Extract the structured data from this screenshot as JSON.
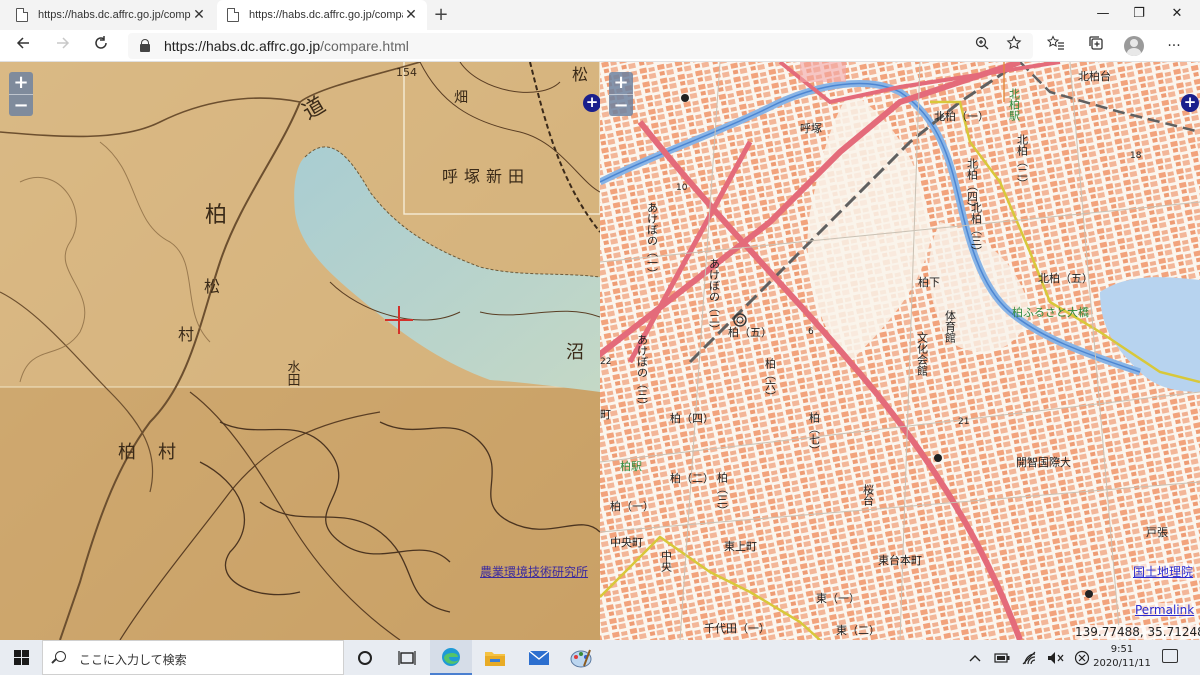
{
  "browser": {
    "tabs": [
      {
        "title": "https://habs.dc.affrc.go.jp/compa",
        "active": false
      },
      {
        "title": "https://habs.dc.affrc.go.jp/compa",
        "active": true
      }
    ],
    "url_host": "https://habs.dc.affrc.go.jp",
    "url_path": "/compare.html",
    "icons": [
      "back-icon",
      "forward-icon",
      "refresh-icon",
      "lock-icon",
      "zoom-icon",
      "favorite-star-icon",
      "favorites-icon",
      "collections-icon",
      "profile-icon",
      "more-icon"
    ]
  },
  "left_map": {
    "zoom_in": "+",
    "zoom_out": "−",
    "credit": "農業環境技術研究所",
    "labels": {
      "kashiwa": "柏",
      "matsu": "松",
      "mura": "村",
      "michi": "道",
      "yobitsuka": "呼塚新田",
      "numa": "沼",
      "hatake": "畑",
      "mizuta": "水田",
      "num154": "154"
    }
  },
  "right_map": {
    "zoom_in": "+",
    "zoom_out": "−",
    "credit": "国土地理院",
    "permalink": "Permalink",
    "coordinates": "139.77488, 35.71248",
    "labels": {
      "kitakashiwadai": "北柏台",
      "kitakashiwa_station": "北柏駅",
      "kitakashiwa1": "北柏（一）",
      "kitakashiwa2": "北柏（二）",
      "kitakashiwa3": "北柏（三）",
      "kitakashiwa4": "北柏（四）",
      "kitakashiwa5": "北柏（五）",
      "yobitsuka": "呼塚",
      "akebono1": "あけぼの（一）",
      "akebono2": "あけぼの（二）",
      "akebono3": "あけぼの（三）",
      "kashiwashita": "柏下",
      "taiikukan": "体育館",
      "bunka": "文化会館",
      "furusato": "柏ふるさと大橋",
      "kashiwa_station": "柏駅",
      "kashiwa1": "柏（一）",
      "kashiwa2": "柏（二）",
      "kashiwa3": "柏（三）",
      "kashiwa4": "柏（四）",
      "kashiwa5": "柏（五）",
      "kashiwa6": "柏（六）",
      "kashiwa7": "柏（七）",
      "chuomachi": "中央町",
      "chuo": "中央",
      "higashiuemachi": "東上町",
      "sakuradai": "桜台",
      "higashidaihonmachi": "東台本町",
      "higashi1": "東（一）",
      "higashi2": "東（二）",
      "chiyoda1": "千代田（一）",
      "kaichi": "開智国際大",
      "tobari": "戸張",
      "ochomachi": "町",
      "num18": "18",
      "num21": "21",
      "num10": "10",
      "num22": "22",
      "num6": "6"
    }
  },
  "taskbar": {
    "search_placeholder": "ここに入力して検索",
    "time": "9:51",
    "date": "2020/11/11",
    "icons": [
      "windows-start-icon",
      "search-icon",
      "cortana-icon",
      "task-view-icon",
      "edge-icon",
      "file-explorer-icon",
      "mail-icon",
      "paint-icon",
      "chevron-up-icon",
      "battery-icon",
      "network-icon",
      "volume-mute-icon",
      "close-circle-icon",
      "notification-icon"
    ]
  }
}
